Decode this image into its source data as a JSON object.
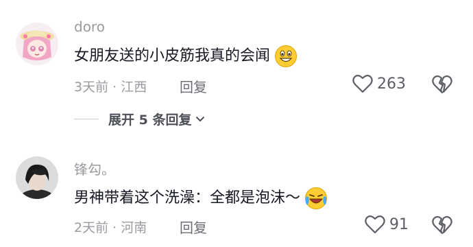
{
  "comments": [
    {
      "username": "doro",
      "text": "女朋友送的小皮筋我真的会闻",
      "emoji": "grinning-face",
      "meta": "3天前 · 江西",
      "reply_label": "回复",
      "likes": "263",
      "avatar": "anime-girl-straw-hat-avatar"
    },
    {
      "username": "锋勾。",
      "text": "男神带着这个洗澡：全都是泡沫～",
      "emoji": "loudly-crying-laughing-face",
      "meta": "2天前 · 河南",
      "reply_label": "回复",
      "likes": "91",
      "avatar": "man-dark-hair-photo-avatar"
    }
  ],
  "expand_replies": {
    "label": "展开 5 条回复"
  },
  "colors": {
    "text": "#161823",
    "secondary": "#9a9ba0",
    "emoji_yellow": "#ffcc33"
  }
}
